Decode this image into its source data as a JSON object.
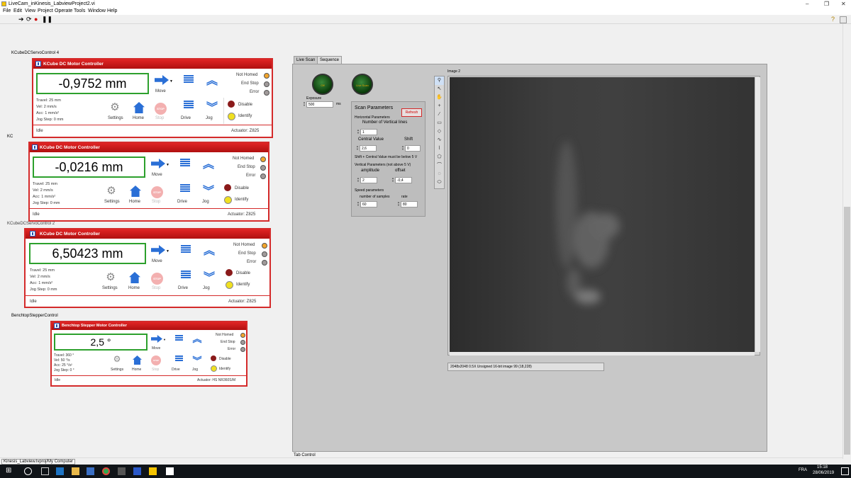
{
  "window": {
    "title": "LiveCam_inKinesis_LabviewProject2.vi"
  },
  "menu": [
    "File",
    "Edit",
    "View",
    "Project",
    "Operate",
    "Tools",
    "Window",
    "Help"
  ],
  "labels": {
    "ctrl1": "KCubeDCServoControl 4",
    "ctrl2": "KC",
    "ctrl3": "KCubeDCServoControl 2",
    "ctrl4": "BenchtopStepperControl",
    "tab_control": "Tab Control",
    "project": "Kinesis_Labview.lvproj/My Computer"
  },
  "controllers": [
    {
      "header": "KCube DC Motor Controller",
      "position": "-0,9752 mm",
      "travel": "Travel: 25 mm",
      "vel": "Vel: 2 mm/s",
      "acc": "Acc: 1 mm/s²",
      "jog": "Jog Step: 0 mm",
      "status": "Idle",
      "actuator": "Actuator:   Z825"
    },
    {
      "header": "KCube DC Motor Controller",
      "position": "-0,0216 mm",
      "travel": "Travel: 25 mm",
      "vel": "Vel: 2 mm/s",
      "acc": "Acc: 1 mm/s²",
      "jog": "Jog Step: 0 mm",
      "status": "Idle",
      "actuator": "Actuator:   Z825"
    },
    {
      "header": "KCube DC Motor Controller",
      "position": "6,50423 mm",
      "travel": "Travel: 25 mm",
      "vel": "Vel: 2 mm/s",
      "acc": "Acc: 1 mm/s²",
      "jog": "Jog Step: 0 mm",
      "status": "Idle",
      "actuator": "Actuator:   Z825"
    },
    {
      "header": "Benchtop Stepper Motor Controller",
      "position": "2,5 °",
      "travel": "Travel: 360 °",
      "vel": "Vel: 50 °/s",
      "acc": "Acc: 25 °/s²",
      "jog": "Jog Step: 0 °",
      "status": "Idle",
      "actuator": "Actuator:   HS NR360S/M"
    }
  ],
  "ctrl_labels": {
    "move": "Move",
    "settings": "Settings",
    "home": "Home",
    "stop": "Stop",
    "drive": "Drive",
    "jog": "Jog",
    "not_homed": "Not Homed",
    "end_stop": "End Stop",
    "error": "Error",
    "disable": "Disable",
    "identify": "Identify"
  },
  "tabs": [
    "Live Scan",
    "Sequence"
  ],
  "live": {
    "led1": "Off",
    "led2": "Live Scan",
    "exposure_label": "Exposure",
    "exposure": "500",
    "exposure_unit": "ms",
    "scan_title": "Scan Parameters",
    "refresh": "Refresh",
    "horizontal": "Horizontal Parameters",
    "num_lines_label": "Number of Vertical lines",
    "num_lines": "1",
    "central_label": "Central Value",
    "shift_label": "Shift",
    "central": "2,6",
    "shift": "0",
    "note": "Shift + Central Value must be below 5 V",
    "vertical": "Vertical Parameters (not above 5 V)",
    "amp_label": "amplitude",
    "offset_label": "offset",
    "amp": "2",
    "offset": "-0,4",
    "speed": "Speed parameters",
    "samples_label": "number of samples",
    "rate_label": "rate",
    "samples": "60",
    "rate": "80"
  },
  "image": {
    "label": "Image 2",
    "status": "2048x2048 0.5X Unsigned 16-bit image 99    (18,228)"
  },
  "taskbar": {
    "lang": "FRA",
    "time": "15:18",
    "date": "28/06/2019"
  }
}
